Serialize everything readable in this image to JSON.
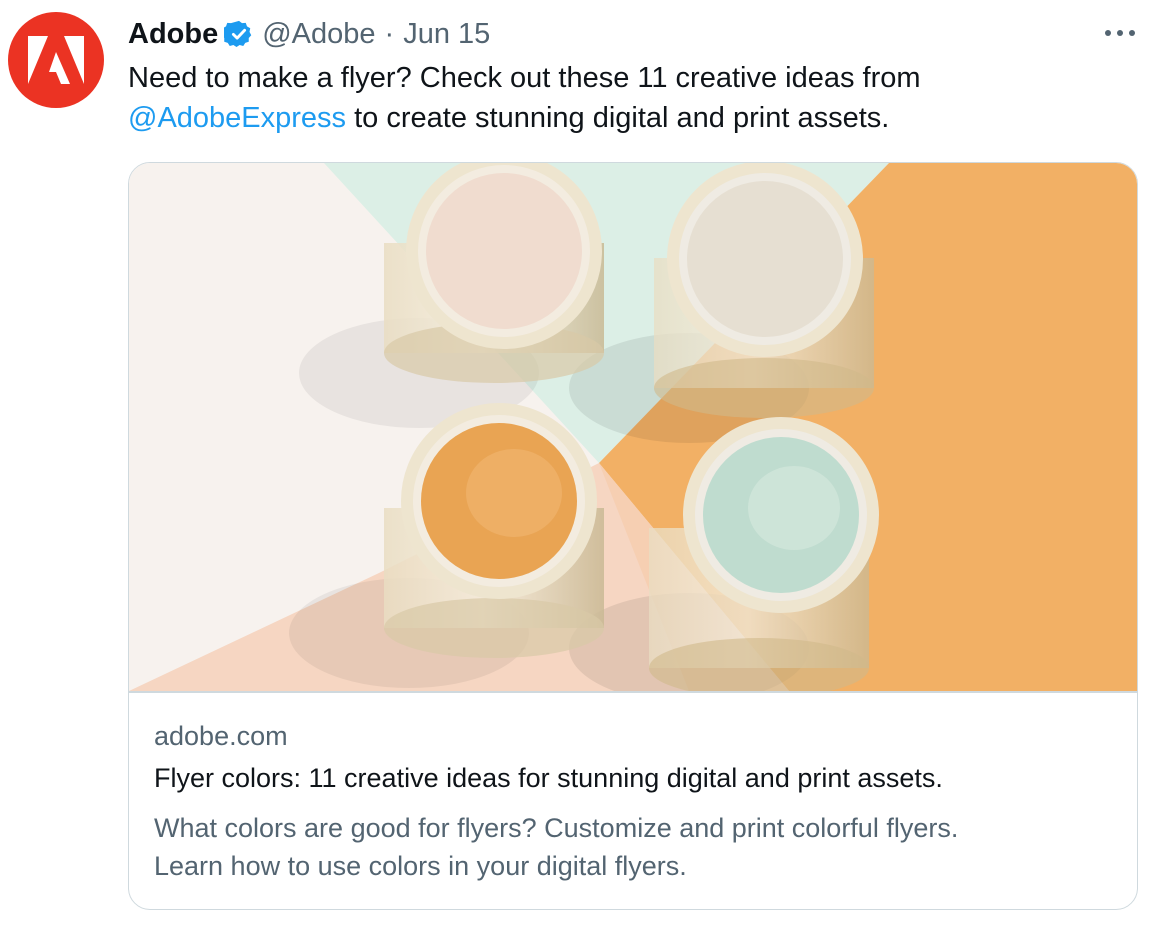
{
  "tweet": {
    "author_name": "Adobe",
    "verified": true,
    "handle": "@Adobe",
    "separator": "·",
    "date": "Jun 15",
    "text_before": "Need to make a flyer? Check out these 11 creative ideas from ",
    "mention": "@AdobeExpress",
    "text_after": " to create stunning digital and print assets.",
    "avatar_icon": "adobe-logo-icon",
    "more_icon": "more-options-icon"
  },
  "card": {
    "image_alt": "Four paint cans on a pastel background",
    "domain": "adobe.com",
    "title": "Flyer colors: 11 creative ideas for stunning digital and print assets.",
    "description_line1": "What colors are good for flyers? Customize and print colorful flyers.",
    "description_line2": "Learn how to use colors in your digital flyers."
  },
  "colors": {
    "avatar_bg": "#eb3323",
    "link": "#1d9bf0",
    "secondary_text": "#536471",
    "verified_badge": "#1d9bf0",
    "image_orange": "#f2b065",
    "image_mint": "#dcefe6",
    "image_peach": "#f6d6c2",
    "image_cream": "#f7f2ee"
  }
}
